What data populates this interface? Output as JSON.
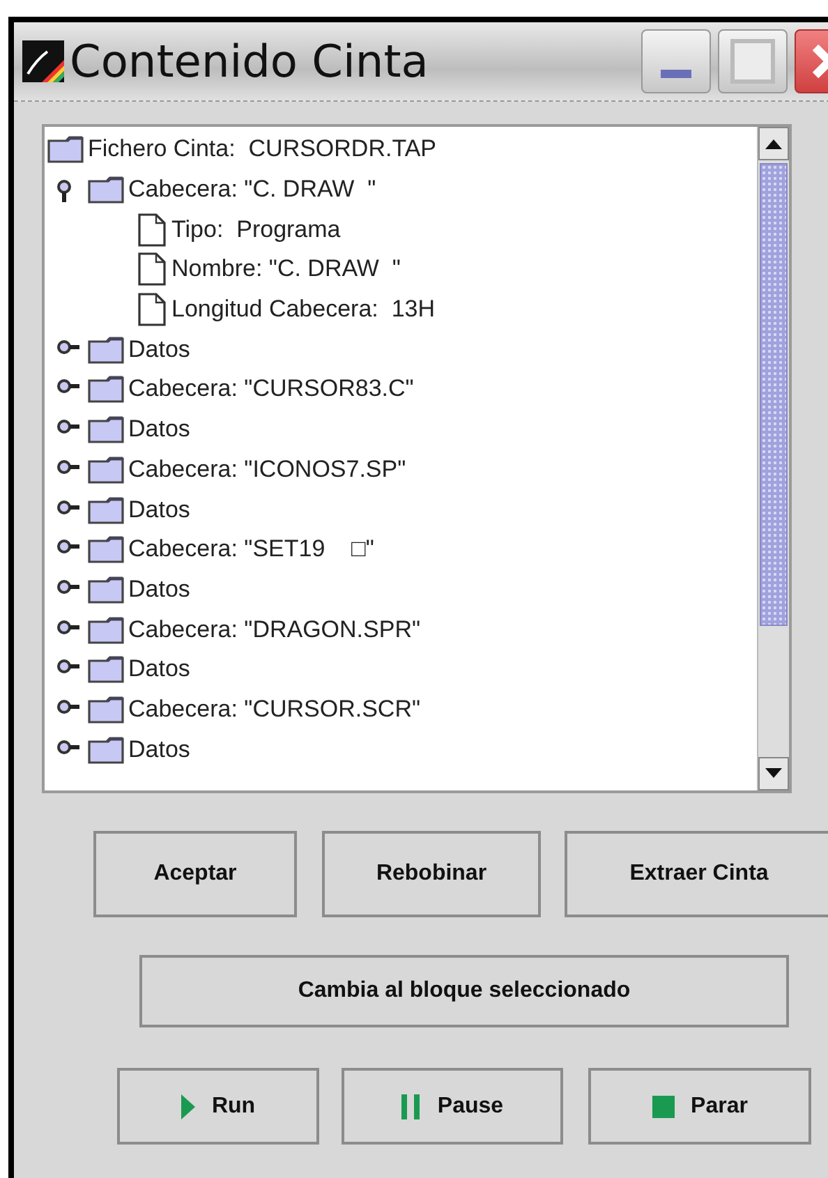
{
  "window": {
    "title": "Contenido Cinta"
  },
  "tree": {
    "label": "Fichero Cinta:  CURSORDR.TAP",
    "kind": "folder",
    "children": [
      {
        "label": "Cabecera: \"C. DRAW  \"",
        "kind": "folder",
        "expanded": true,
        "children": [
          {
            "label": "Tipo:  Programa",
            "kind": "file"
          },
          {
            "label": "Nombre: \"C. DRAW  \"",
            "kind": "file"
          },
          {
            "label": "Longitud Cabecera:  13H",
            "kind": "file"
          }
        ]
      },
      {
        "label": "Datos",
        "kind": "folder",
        "expanded": false
      },
      {
        "label": "Cabecera: \"CURSOR83.C\"",
        "kind": "folder",
        "expanded": false
      },
      {
        "label": "Datos",
        "kind": "folder",
        "expanded": false
      },
      {
        "label": "Cabecera: \"ICONOS7.SP\"",
        "kind": "folder",
        "expanded": false
      },
      {
        "label": "Datos",
        "kind": "folder",
        "expanded": false
      },
      {
        "label": "Cabecera: \"SET19    □\"",
        "kind": "folder",
        "expanded": false
      },
      {
        "label": "Datos",
        "kind": "folder",
        "expanded": false
      },
      {
        "label": "Cabecera: \"DRAGON.SPR\"",
        "kind": "folder",
        "expanded": false
      },
      {
        "label": "Datos",
        "kind": "folder",
        "expanded": false
      },
      {
        "label": "Cabecera: \"CURSOR.SCR\"",
        "kind": "folder",
        "expanded": false
      },
      {
        "label": "Datos",
        "kind": "folder",
        "expanded": false
      }
    ]
  },
  "button_rows": [
    [
      {
        "label": "Aceptar",
        "kind": "plain"
      },
      {
        "label": "Rebobinar",
        "kind": "plain"
      },
      {
        "label": "Extraer Cinta",
        "kind": "plain"
      }
    ],
    [
      {
        "label": "Cambia al bloque seleccionado",
        "kind": "plain"
      }
    ],
    [
      {
        "label": "Run",
        "kind": "play"
      },
      {
        "label": "Pause",
        "kind": "pause"
      },
      {
        "label": "Parar",
        "kind": "stop"
      }
    ]
  ]
}
